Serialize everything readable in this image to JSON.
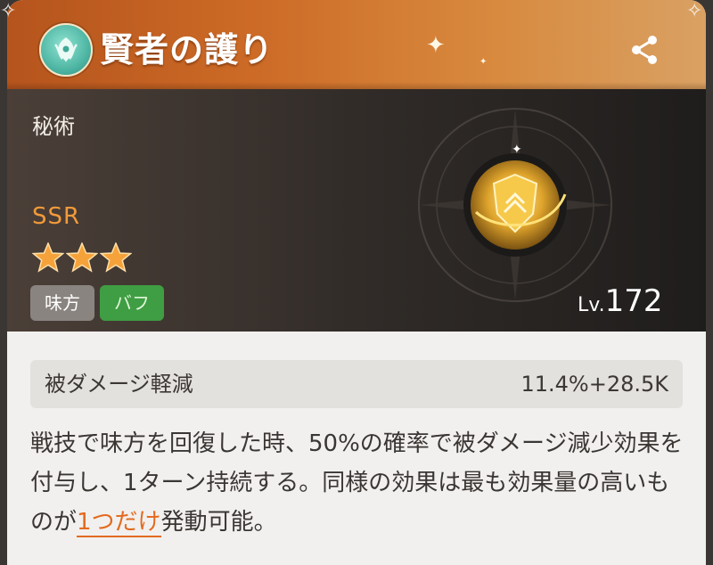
{
  "header": {
    "title": "賢者の護り",
    "emblem_icon": "sage-emblem-icon",
    "share_icon": "share-icon"
  },
  "hero": {
    "category": "秘術",
    "rarity": "SSR",
    "stars": 3,
    "tags": [
      "味方",
      "バフ"
    ],
    "level_prefix": "Lv.",
    "level_value": "172",
    "item_icon": "golden-shield-icon"
  },
  "stat": {
    "name": "被ダメージ軽減",
    "value": "11.4%+28.5K"
  },
  "description": {
    "before": "戦技で味方を回復した時、50%の確率で被ダメージ減少効果を付与し、1ターン持続する。同様の効果は最も効果量の高いものが",
    "highlight": "1つだけ",
    "after": "発動可能。"
  },
  "colors": {
    "header_accent": "#cc6a26",
    "rarity": "#f29a3a",
    "buff_tag": "#3f9e43",
    "highlight": "#e36a1f"
  }
}
